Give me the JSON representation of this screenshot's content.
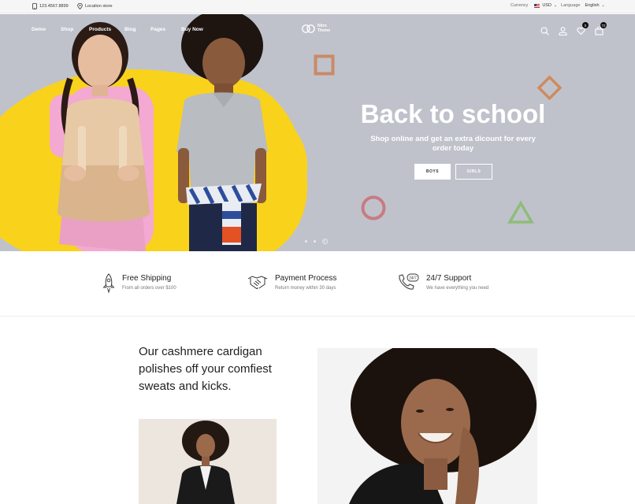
{
  "topbar": {
    "phone": "123.4567.8899",
    "location": "Location store",
    "currency_label": "Currency",
    "currency_value": "USD",
    "language_label": "Language",
    "language_value": "English"
  },
  "header": {
    "nav": [
      "Demo",
      "Shop",
      "Products",
      "Blog",
      "Pages",
      "Buy Now"
    ],
    "logo_line1": "Nitro",
    "logo_line2": "Theme",
    "wishlist_count": "0",
    "cart_count": "72",
    "icons": [
      "search-icon",
      "user-icon",
      "heart-icon",
      "cart-icon"
    ]
  },
  "hero": {
    "title": "Back to school",
    "subtitle": "Shop online and get an extra dicount for every order today",
    "button_boys": "BOYS",
    "button_girls": "GIRLS",
    "slides_total": 3,
    "active_slide": 3,
    "colors": {
      "background": "#bfc2cb",
      "blob": "#f9d21c",
      "square": "#c98a67",
      "diamond": "#cf8a5e",
      "circle": "#c87b83",
      "triangle": "#8fbc7a"
    }
  },
  "features": [
    {
      "icon": "rocket-icon",
      "title": "Free Shipping",
      "desc": "From all orders over $100"
    },
    {
      "icon": "handshake-icon",
      "title": "Payment Process",
      "desc": "Return money within 30 days"
    },
    {
      "icon": "support-24-7-icon",
      "title": "24/7 Support",
      "desc": "We have everything you need"
    }
  ],
  "promo": {
    "headline": "Our cashmere cardigan polishes off your comfiest sweats and kicks."
  }
}
